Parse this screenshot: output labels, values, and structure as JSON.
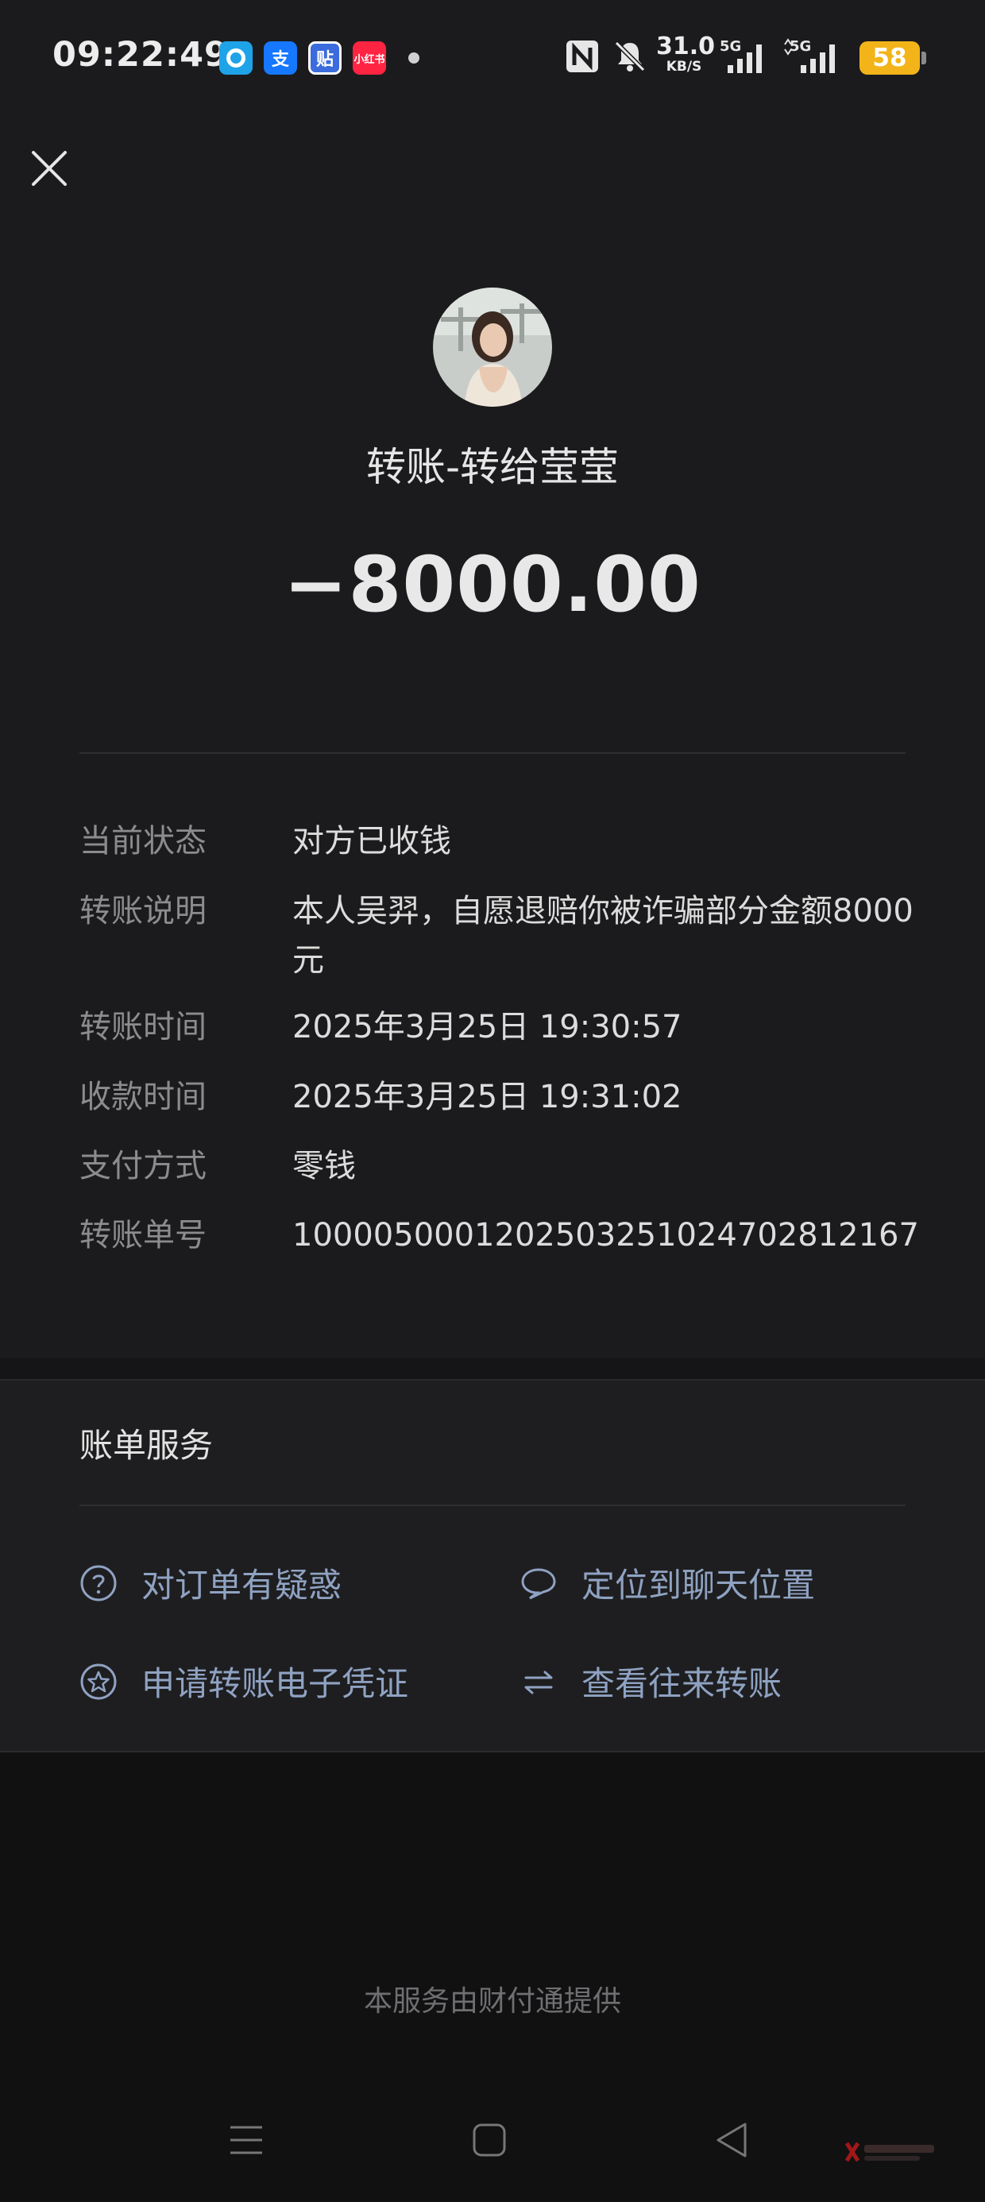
{
  "status_bar": {
    "time": "09:22:49",
    "apps": [
      {
        "icon": "app-1-icon",
        "label": "",
        "color": "#1fa3e8"
      },
      {
        "icon": "alipay-icon",
        "label": "支",
        "color": "#1677ff"
      },
      {
        "icon": "tieba-icon",
        "label": "贴",
        "color": "#3b6bdc"
      },
      {
        "icon": "xiaohongshu-icon",
        "label": "小红书",
        "color": "#ff2442"
      }
    ],
    "net_speed": "31.0",
    "net_unit": "KB/S",
    "signal1": "5G",
    "signal2": "5G",
    "battery": "58"
  },
  "header": {
    "title": "转账-转给莹莹",
    "amount": "−8000.00"
  },
  "details": [
    {
      "key": "当前状态",
      "value": "对方已收钱"
    },
    {
      "key": "转账说明",
      "value": "本人吴羿，自愿退赔你被诈骗部分金额8000元"
    },
    {
      "key": "转账时间",
      "value": "2025年3月25日 19:30:57"
    },
    {
      "key": "收款时间",
      "value": "2025年3月25日 19:31:02"
    },
    {
      "key": "支付方式",
      "value": "零钱"
    },
    {
      "key": "转账单号",
      "value": "100005000120250325102470281216​7"
    }
  ],
  "services": {
    "title": "账单服务",
    "items": [
      {
        "label": "对订单有疑惑",
        "icon": "question-icon"
      },
      {
        "label": "定位到聊天位置",
        "icon": "chat-bubble-icon"
      },
      {
        "label": "申请转账电子凭证",
        "icon": "certificate-star-icon"
      },
      {
        "label": "查看往来转账",
        "icon": "swap-arrows-icon"
      }
    ]
  },
  "footer": "本服务由财付通提供",
  "colors": {
    "background": "#1b1b1d",
    "link": "#8fa2c2",
    "battery": "#f3b419"
  }
}
